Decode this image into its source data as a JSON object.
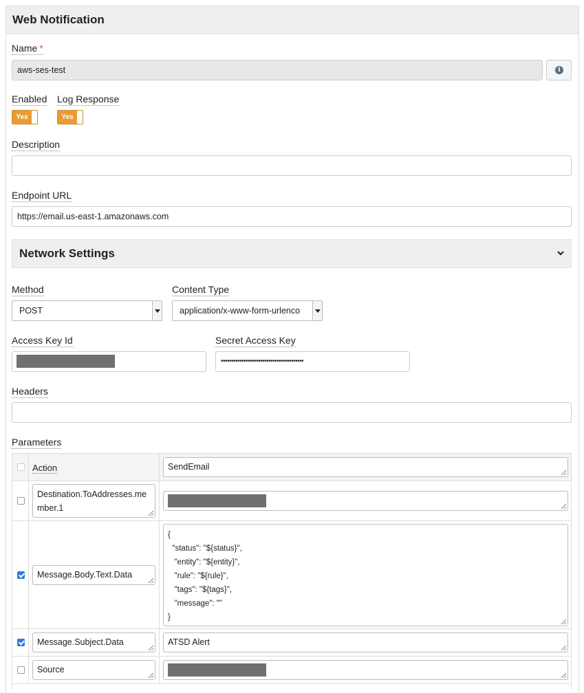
{
  "panel": {
    "title": "Web Notification"
  },
  "name_field": {
    "label": "Name",
    "required_mark": "*",
    "value": "aws-ses-test",
    "info_glyph": "i",
    "info_icon": "info-circle-icon"
  },
  "enabled": {
    "label": "Enabled",
    "toggle_text": "Yes",
    "value": true
  },
  "log_response": {
    "label": "Log Response",
    "toggle_text": "Yes",
    "value": true
  },
  "description": {
    "label": "Description",
    "value": ""
  },
  "endpoint": {
    "label": "Endpoint URL",
    "value": "https://email.us-east-1.amazonaws.com"
  },
  "network": {
    "title": "Network Settings",
    "collapse_icon": "chevron-down-icon",
    "method": {
      "label": "Method",
      "value": "POST"
    },
    "content_type": {
      "label": "Content Type",
      "value": "application/x-www-form-urlenco"
    },
    "access_key": {
      "label": "Access Key Id",
      "value": ""
    },
    "secret_key": {
      "label": "Secret Access Key",
      "value": "••••••••••••••••••••••••••••••••••••••••"
    },
    "headers": {
      "label": "Headers",
      "value": ""
    }
  },
  "parameters": {
    "label": "Parameters",
    "header_name": "Action",
    "header_value": "SendEmail",
    "rows": [
      {
        "checked": false,
        "name_line1": "Destination.ToAddresses.me",
        "name_line2": "mber.1",
        "value": ""
      },
      {
        "checked": true,
        "name": "Message.Body.Text.Data",
        "value_lines": [
          "{",
          "  \"status\": \"${status}\",",
          "   \"entity\": \"${entity}\",",
          "   \"rule\": \"${rule}\",",
          "   \"tags\": \"${tags}\",",
          "   \"message\": \"\"",
          "}"
        ]
      },
      {
        "checked": true,
        "name": "Message.Subject.Data",
        "value": "ATSD Alert"
      },
      {
        "checked": false,
        "name": "Source",
        "value": ""
      }
    ]
  },
  "colors": {
    "toggle_on": "#ec9a33",
    "checkbox_checked": "#2d7be0",
    "required": "#d9534f",
    "mask": "#707070"
  }
}
